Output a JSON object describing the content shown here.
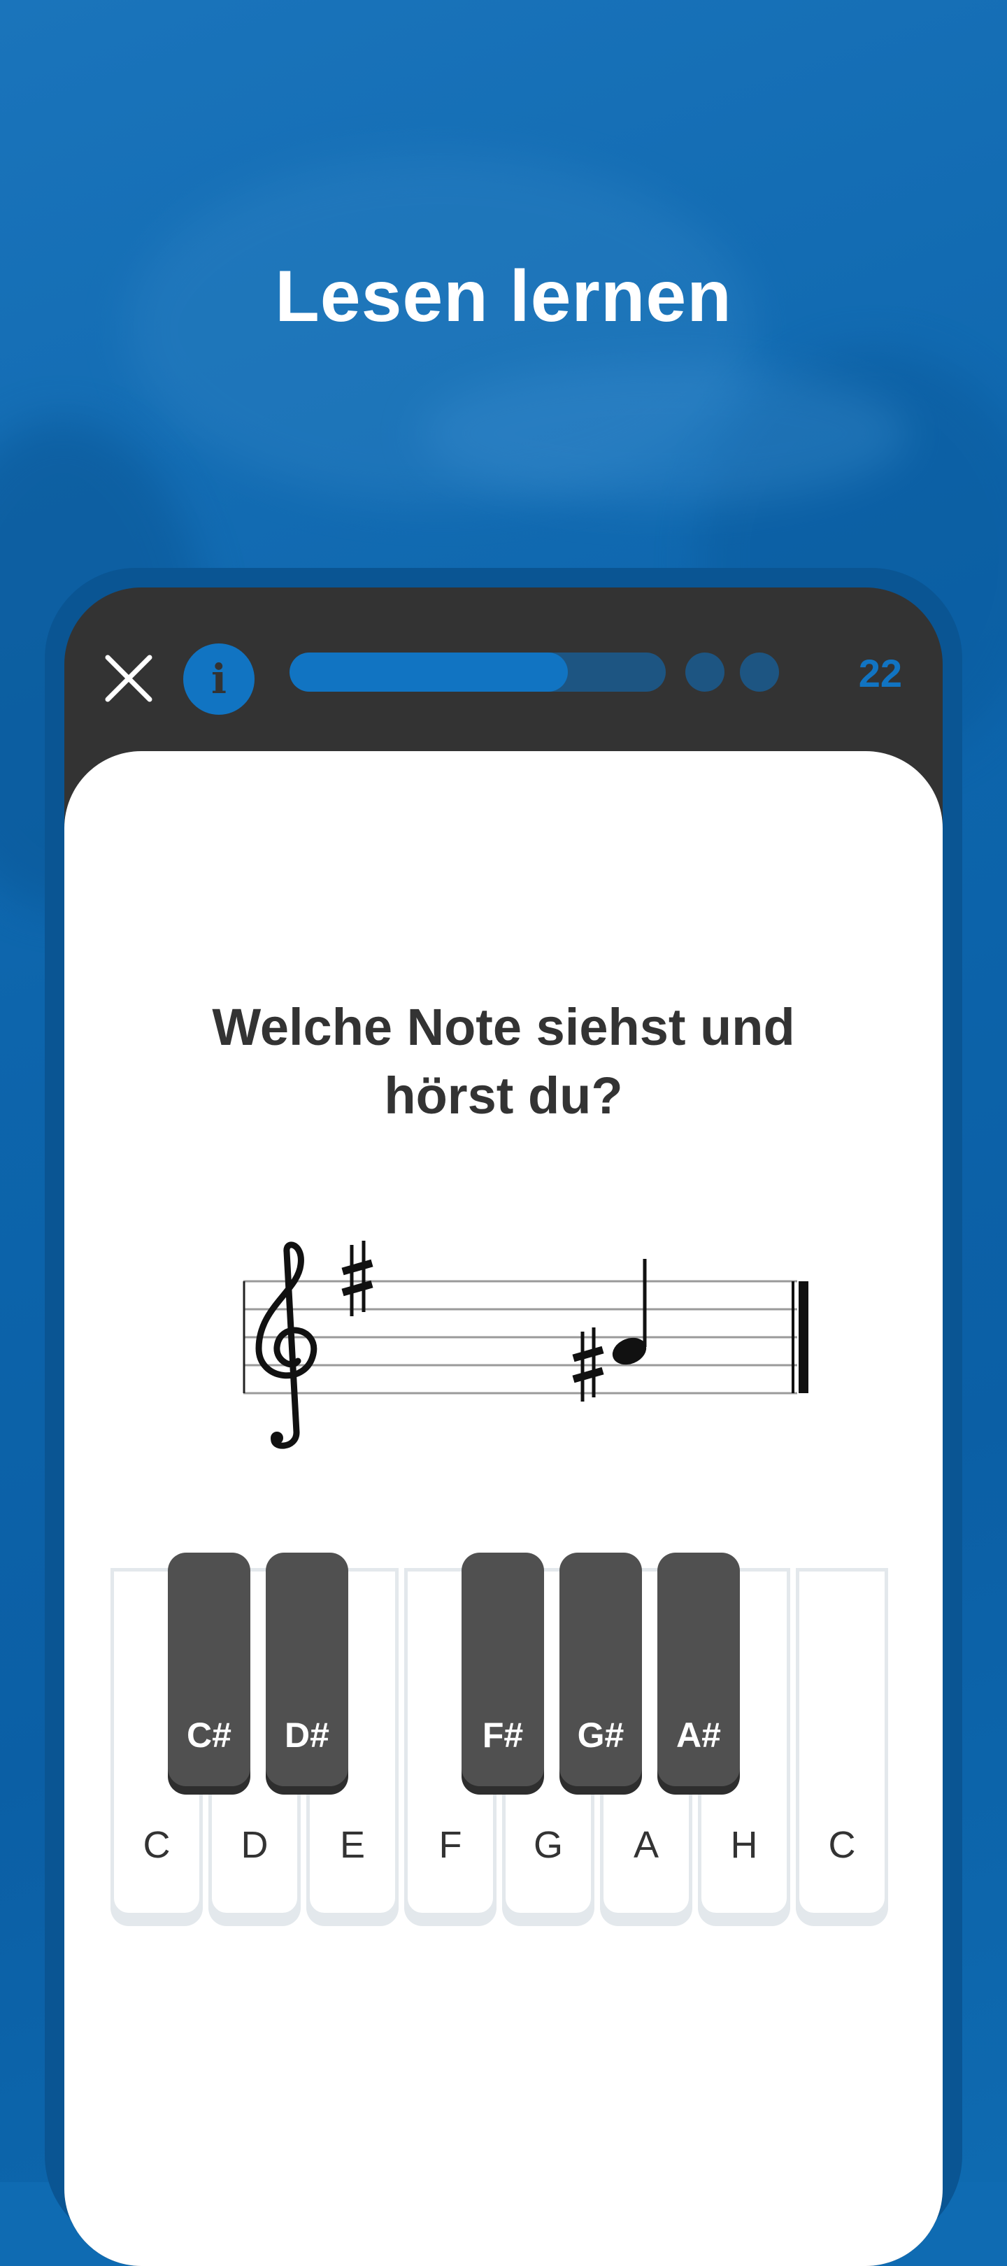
{
  "header": {
    "title": "Lesen lernen"
  },
  "topbar": {
    "progress_fraction": 0.74,
    "counter": "22",
    "accent_color": "#1174c2"
  },
  "question": {
    "line1": "Welche Note siehst und",
    "line2": "hörst du?"
  },
  "staff": {
    "clef": "treble",
    "key_signature": [
      "F#"
    ],
    "note": {
      "accidental": "sharp",
      "pitch": "G#",
      "duration": "quarter"
    }
  },
  "piano": {
    "white_keys": [
      "C",
      "D",
      "E",
      "F",
      "G",
      "A",
      "H",
      "C"
    ],
    "black_keys": [
      "C#",
      "D#",
      "F#",
      "G#",
      "A#"
    ]
  }
}
